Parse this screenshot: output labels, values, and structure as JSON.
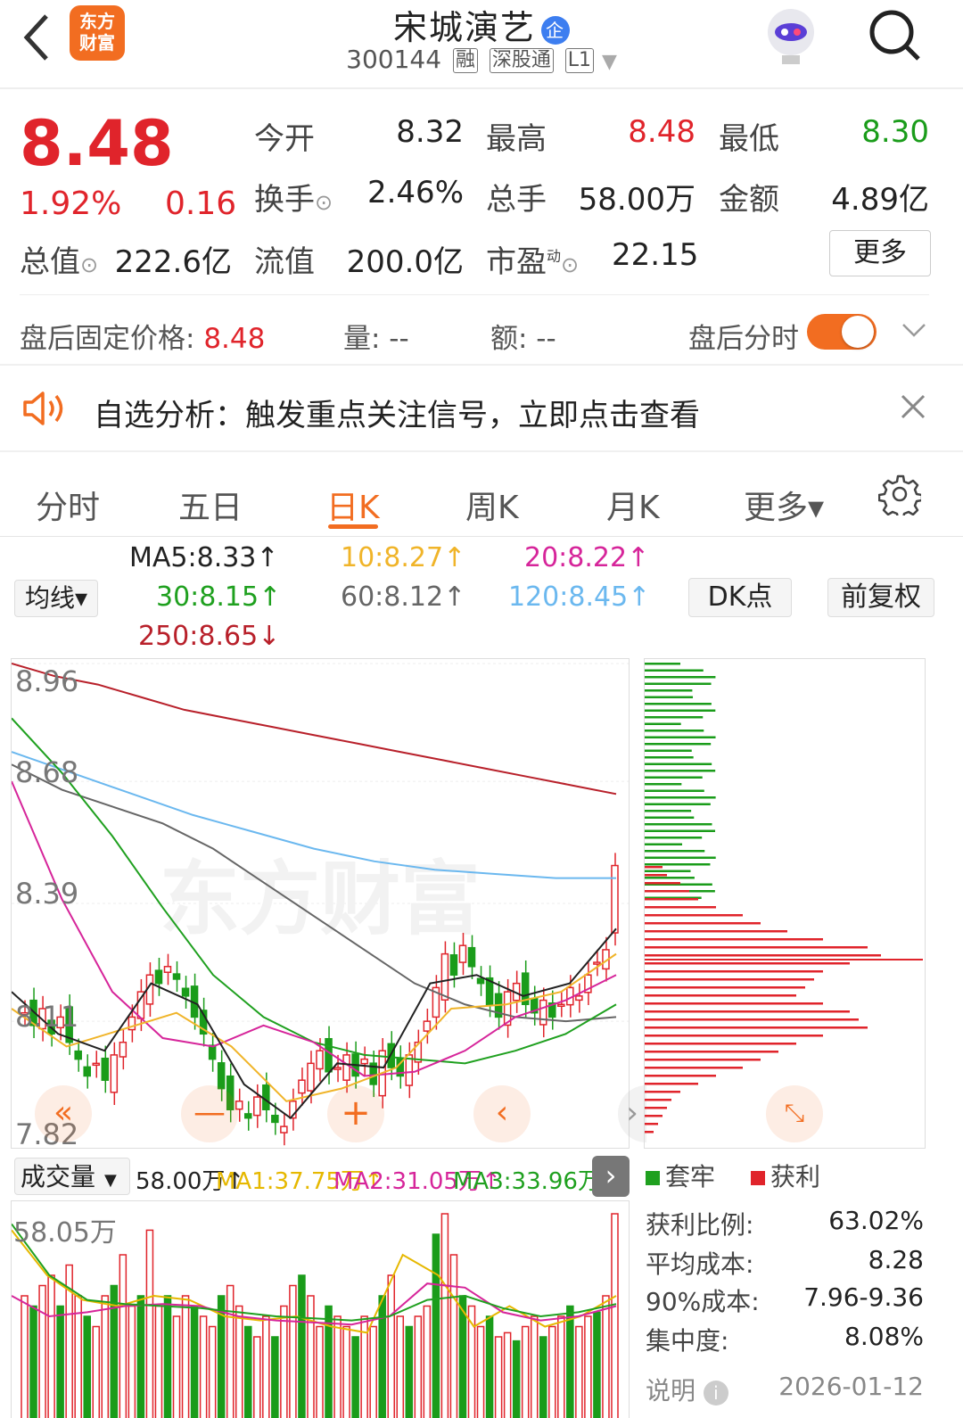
{
  "header": {
    "back_label": "<",
    "logo_line1": "东方",
    "logo_line2": "财富",
    "title": "宋城演艺",
    "title_badge": "企",
    "code": "300144",
    "tags": [
      "融",
      "深股通",
      "L1"
    ]
  },
  "quote": {
    "price": "8.48",
    "pct": "1.92%",
    "chg": "0.16",
    "open_label": "今开",
    "open": "8.32",
    "high_label": "最高",
    "high": "8.48",
    "low_label": "最低",
    "low": "8.30",
    "turnover_label": "换手",
    "turnover": "2.46%",
    "volume_label": "总手",
    "volume": "58.00万",
    "amount_label": "金额",
    "amount": "4.89亿",
    "mktcap_label": "总值",
    "mktcap": "222.6亿",
    "float_label": "流值",
    "float": "200.0亿",
    "pe_label": "市盈",
    "pe_sup": "动",
    "pe": "22.15",
    "more_label": "更多"
  },
  "afterhours": {
    "price_label": "盘后固定价格: ",
    "price": "8.48",
    "vol_label": "量: --",
    "amt_label": "额: --",
    "intraday_label": "盘后分时"
  },
  "notice": {
    "text": "自选分析：触发重点关注信号，立即点击查看"
  },
  "tabs": [
    "分时",
    "五日",
    "日K",
    "周K",
    "月K",
    "更多▾"
  ],
  "active_tab": "日K",
  "ma": {
    "avg_label": "均线▾",
    "ma5": "MA5:8.33↑",
    "ma10": "10:8.27↑",
    "ma20": "20:8.22↑",
    "ma30": "30:8.15↑",
    "ma60": "60:8.12↑",
    "ma120": "120:8.45↑",
    "ma250": "250:8.65↓",
    "dk_label": "DK点",
    "adj_label": "前复权"
  },
  "price_axis": [
    "8.96",
    "8.68",
    "8.39",
    "8.11",
    "7.82"
  ],
  "watermark": "东方财富",
  "volume": {
    "selector": "成交量",
    "vol": "58.00万↑",
    "ma1": "MA1:37.75万↑",
    "ma2": "MA2:31.05万↑",
    "ma3": "MA3:33.96万↑",
    "axis_top": "58.05万"
  },
  "chips": {
    "legend_trap": "套牢",
    "legend_profit": "获利",
    "profit_ratio_label": "获利比例:",
    "profit_ratio": "63.02%",
    "avg_cost_label": "平均成本:",
    "avg_cost": "8.28",
    "cost90_label": "90%成本:",
    "cost90": "7.96-9.36",
    "concentration_label": "集中度:",
    "concentration": "8.08%",
    "note_label": "说明",
    "date": "2026-01-12"
  },
  "colors": {
    "up": "#e0242b",
    "down": "#1a9c1a",
    "accent": "#f26d21",
    "ma5": "#222222",
    "ma10": "#f0b429",
    "ma20": "#d6259a",
    "ma30": "#1fa01f",
    "ma60": "#666666",
    "ma120": "#6bb8ef",
    "ma250": "#b8202a"
  },
  "chart_data": {
    "type": "candlestick",
    "ylim": [
      7.82,
      8.96
    ],
    "last": {
      "open": 8.32,
      "high": 8.48,
      "low": 8.3,
      "close": 8.48
    }
  }
}
